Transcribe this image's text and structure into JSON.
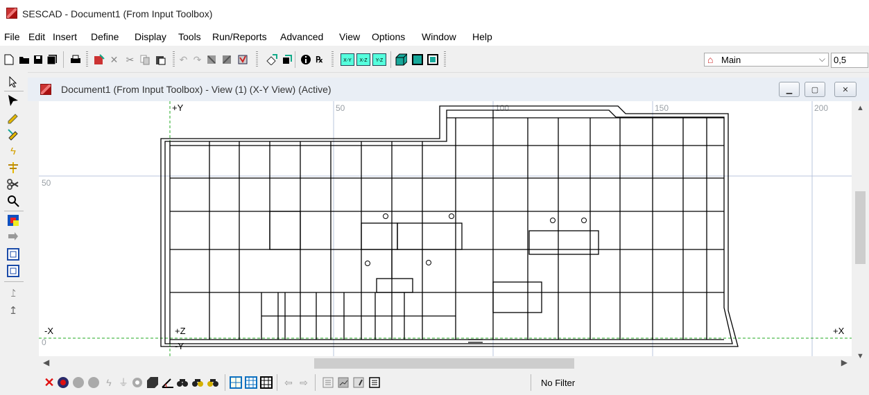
{
  "app": {
    "title": "SESCAD - Document1 (From Input Toolbox)"
  },
  "menu": [
    "File",
    "Edit",
    "Insert",
    "Define",
    "Display",
    "Tools",
    "Run/Reports",
    "Advanced",
    "View",
    "Options",
    "Window",
    "Help"
  ],
  "toolbar": {
    "view_combo_value": "Main",
    "value_field": "0,5",
    "view_buttons": [
      "X-Y",
      "X-Z",
      "Y-Z"
    ]
  },
  "child_window": {
    "title": "Document1 (From Input Toolbox) - View (1) (X-Y View) (Active)"
  },
  "canvas": {
    "ruler_top": [
      "50",
      "100",
      "150",
      "200"
    ],
    "ruler_left": [
      "50",
      "0"
    ],
    "axis_labels": {
      "plus_y": "+Y",
      "minus_x": "-X",
      "plus_z": "+Z",
      "minus_y": "-Y",
      "plus_x": "+X"
    }
  },
  "bottom_toolbar": {
    "filter_label": "No Filter"
  },
  "colors": {
    "axis_green": "#22aa22",
    "grid_blue": "#b8c4dc",
    "ruler_text": "#9aa0a6",
    "accent_teal": "#17a89a"
  }
}
